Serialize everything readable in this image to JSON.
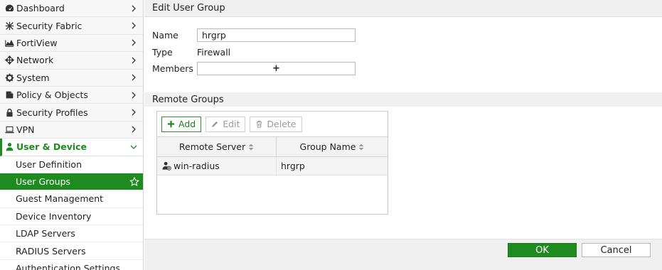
{
  "sidebar": {
    "items": [
      {
        "label": "Dashboard",
        "icon": "dashboard-icon"
      },
      {
        "label": "Security Fabric",
        "icon": "security-fabric-icon"
      },
      {
        "label": "FortiView",
        "icon": "fortiview-icon"
      },
      {
        "label": "Network",
        "icon": "network-icon"
      },
      {
        "label": "System",
        "icon": "gear-icon"
      },
      {
        "label": "Policy & Objects",
        "icon": "policy-icon"
      },
      {
        "label": "Security Profiles",
        "icon": "lock-icon"
      },
      {
        "label": "VPN",
        "icon": "vpn-icon"
      },
      {
        "label": "User & Device",
        "icon": "user-icon"
      }
    ],
    "sub_items": [
      "User Definition",
      "User Groups",
      "Guest Management",
      "Device Inventory",
      "LDAP Servers",
      "RADIUS Servers",
      "Authentication Settings"
    ],
    "active_sub": "User Groups",
    "accent_color": "#1f8a1f"
  },
  "header": {
    "title": "Edit User Group"
  },
  "form": {
    "name_label": "Name",
    "name_value": "hrgrp",
    "type_label": "Type",
    "type_value": "Firewall",
    "members_label": "Members",
    "members_add": "+"
  },
  "remote_groups": {
    "title": "Remote Groups",
    "toolbar": {
      "add": "Add",
      "edit": "Edit",
      "delete": "Delete"
    },
    "columns": [
      "Remote Server",
      "Group Name"
    ],
    "rows": [
      {
        "server": "win-radius",
        "group": "hrgrp"
      }
    ]
  },
  "footer": {
    "ok": "OK",
    "cancel": "Cancel"
  }
}
